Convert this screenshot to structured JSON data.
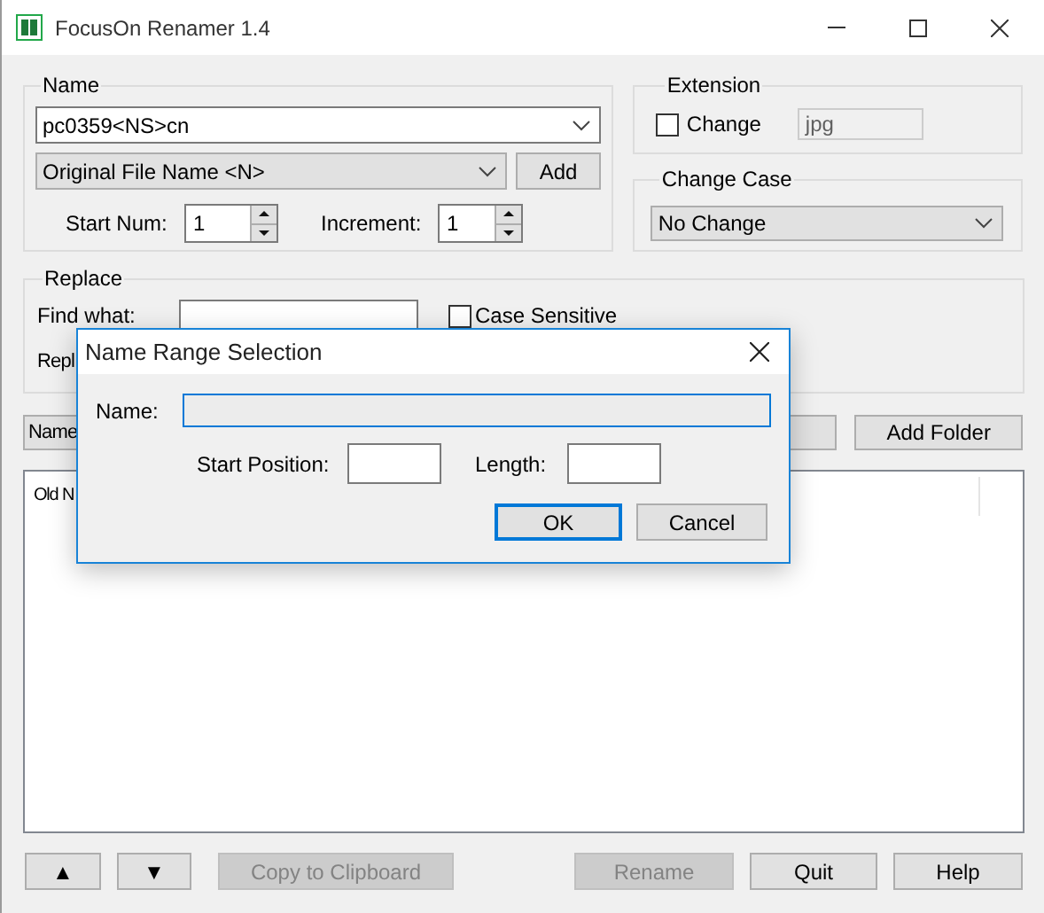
{
  "window": {
    "title": "FocusOn Renamer 1.4"
  },
  "name_group": {
    "label": "Name",
    "pattern": "pc0359<NS>cn",
    "token": "Original File Name <N>",
    "add_button": "Add",
    "start_num": {
      "label": "Start Num:",
      "value": "1"
    },
    "increment": {
      "label": "Increment:",
      "value": "1"
    }
  },
  "extension": {
    "label": "Extension",
    "change": {
      "label": "Change",
      "checked": false
    },
    "value": "jpg",
    "disabled": true
  },
  "change_case": {
    "label": "Change Case",
    "value": "No Change"
  },
  "replace": {
    "label": "Replace",
    "find_label": "Find what:",
    "case_sensitive": {
      "label": "Case Sensitive",
      "checked": false
    },
    "replace_label": "Repl"
  },
  "list_toolbar": {
    "name_button": "Name",
    "add_folder": "Add Folder"
  },
  "file_list": {
    "column_1": "Old N"
  },
  "buttons": [
    {
      "label": "▲",
      "disabled": false
    },
    {
      "label": "▼",
      "disabled": false
    },
    {
      "label": "Copy to Clipboard",
      "disabled": true
    },
    {
      "label": "Rename",
      "disabled": true
    },
    {
      "label": "Quit",
      "disabled": false
    },
    {
      "label": "Help",
      "disabled": false
    }
  ],
  "dialog": {
    "title": "Name Range Selection",
    "name_label": "Name:",
    "start_label": "Start Position:",
    "length_label": "Length:",
    "buttons": [
      {
        "label": "OK",
        "default": true
      },
      {
        "label": "Cancel",
        "default": false
      }
    ]
  }
}
